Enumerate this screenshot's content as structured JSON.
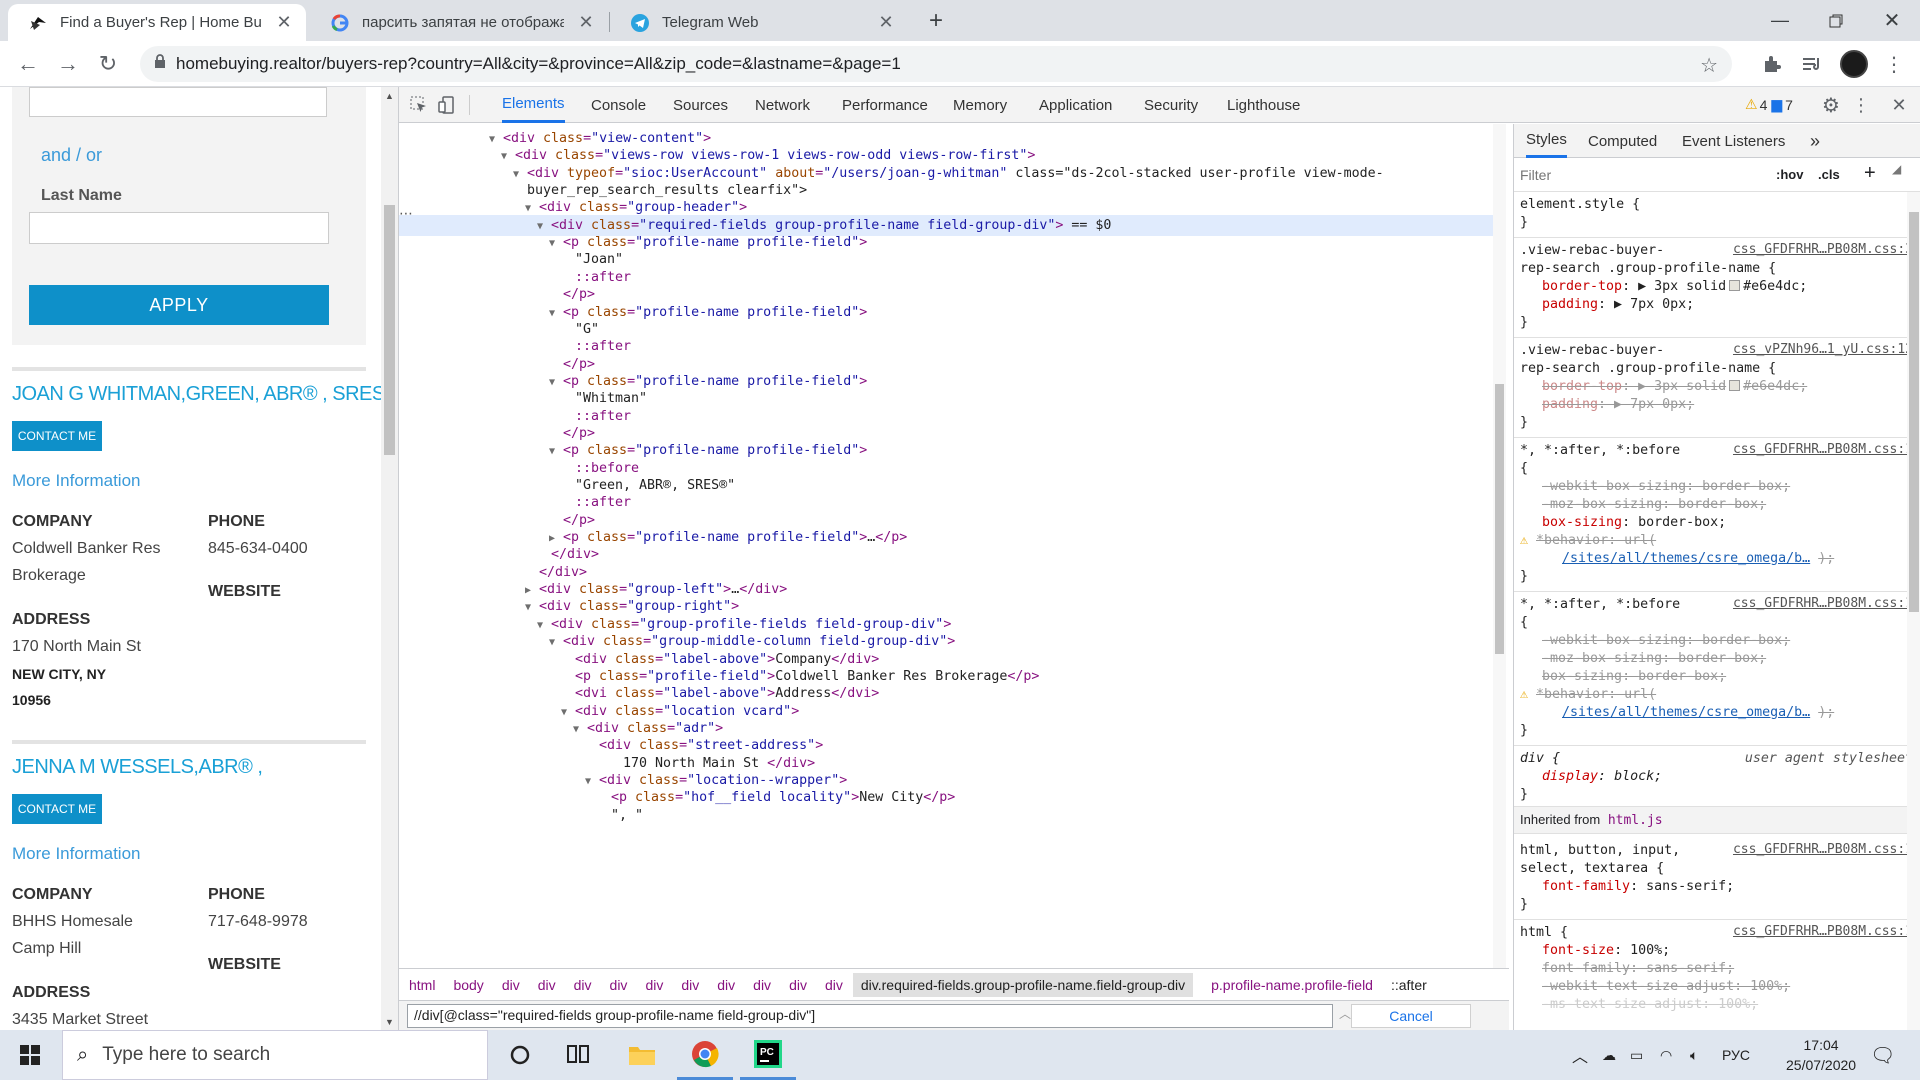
{
  "browser": {
    "tabs": [
      {
        "title": "Find a Buyer's Rep | Home Buying",
        "icon": "realtor-icon",
        "active": true
      },
      {
        "title": "парсить запятая не отображаю",
        "icon": "google-icon",
        "active": false
      },
      {
        "title": "Telegram Web",
        "icon": "telegram-icon",
        "active": false
      }
    ],
    "url": "homebuying.realtor/buyers-rep?country=All&city=&province=All&zip_code=&lastname=&page=1"
  },
  "website": {
    "and_or": "and / or",
    "last_name_label": "Last Name",
    "apply": "APPLY",
    "agents": [
      {
        "name": "JOAN G WHITMAN,GREEN, ABR® , SRES® ,",
        "contact": "CONTACT ME",
        "more": "More Information",
        "company_label": "COMPANY",
        "company_line1": "Coldwell Banker Res",
        "company_line2": "Brokerage",
        "phone_label": "PHONE",
        "phone": "845-634-0400",
        "website_label": "WEBSITE",
        "address_label": "ADDRESS",
        "street": "170 North Main St",
        "city": "NEW CITY, NY",
        "zip": "10956"
      },
      {
        "name": "JENNA M WESSELS,ABR® ,",
        "contact": "CONTACT ME",
        "more": "More Information",
        "company_label": "COMPANY",
        "company_line1": "BHHS Homesale",
        "company_line2": "Camp Hill",
        "phone_label": "PHONE",
        "phone": "717-648-9978",
        "website_label": "WEBSITE",
        "address_label": "ADDRESS",
        "street": "3435 Market Street"
      }
    ]
  },
  "devtools": {
    "tabs": [
      "Elements",
      "Console",
      "Sources",
      "Network",
      "Performance",
      "Memory",
      "Application",
      "Security",
      "Lighthouse"
    ],
    "warnings": "4",
    "messages": "7",
    "dom_lines": [
      {
        "indent": 7,
        "tri": "▼",
        "html": "<div class=\"view-content\">"
      },
      {
        "indent": 8,
        "tri": "▼",
        "html": "<div class=\"views-row views-row-1 views-row-odd views-row-first\">"
      },
      {
        "indent": 9,
        "tri": "▼",
        "html": "<div typeof=\"sioc:UserAccount\" about=\"/users/joan-g-whitman\" class=\"ds-2col-stacked user-profile view-mode-"
      },
      {
        "indent": 9,
        "tri": "",
        "html": "buyer_rep_search_results clearfix\">"
      },
      {
        "indent": 10,
        "tri": "▼",
        "html": "<div class=\"group-header\">"
      },
      {
        "indent": 11,
        "tri": "▼",
        "html": "<div class=\"required-fields group-profile-name field-group-div\"> == $0",
        "selected": true
      },
      {
        "indent": 12,
        "tri": "▼",
        "html": "<p class=\"profile-name profile-field\">"
      },
      {
        "indent": 13,
        "tri": "",
        "html": "\"Joan\""
      },
      {
        "indent": 13,
        "tri": "",
        "html": "::after"
      },
      {
        "indent": 12,
        "tri": "",
        "html": "</p>"
      },
      {
        "indent": 12,
        "tri": "▼",
        "html": "<p class=\"profile-name profile-field\">"
      },
      {
        "indent": 13,
        "tri": "",
        "html": "\"G\""
      },
      {
        "indent": 13,
        "tri": "",
        "html": "::after"
      },
      {
        "indent": 12,
        "tri": "",
        "html": "</p>"
      },
      {
        "indent": 12,
        "tri": "▼",
        "html": "<p class=\"profile-name profile-field\">"
      },
      {
        "indent": 13,
        "tri": "",
        "html": "\"Whitman\""
      },
      {
        "indent": 13,
        "tri": "",
        "html": "::after"
      },
      {
        "indent": 12,
        "tri": "",
        "html": "</p>"
      },
      {
        "indent": 12,
        "tri": "▼",
        "html": "<p class=\"profile-name profile-field\">"
      },
      {
        "indent": 13,
        "tri": "",
        "html": "::before"
      },
      {
        "indent": 13,
        "tri": "",
        "html": "\"Green, ABR®, SRES®\""
      },
      {
        "indent": 13,
        "tri": "",
        "html": "::after"
      },
      {
        "indent": 12,
        "tri": "",
        "html": "</p>"
      },
      {
        "indent": 12,
        "tri": "▶",
        "html": "<p class=\"profile-name profile-field\">…</p>"
      },
      {
        "indent": 11,
        "tri": "",
        "html": "</div>"
      },
      {
        "indent": 10,
        "tri": "",
        "html": "</div>"
      },
      {
        "indent": 10,
        "tri": "▶",
        "html": "<div class=\"group-left\">…</div>"
      },
      {
        "indent": 10,
        "tri": "▼",
        "html": "<div class=\"group-right\">"
      },
      {
        "indent": 11,
        "tri": "▼",
        "html": "<div class=\"group-profile-fields field-group-div\">"
      },
      {
        "indent": 12,
        "tri": "▼",
        "html": "<div class=\"group-middle-column field-group-div\">"
      },
      {
        "indent": 13,
        "tri": "",
        "html": "<div class=\"label-above\">Company</div>"
      },
      {
        "indent": 13,
        "tri": "",
        "html": "<p class=\"profile-field\">Coldwell Banker Res Brokerage</p>"
      },
      {
        "indent": 13,
        "tri": "",
        "html": "<dvi class=\"label-above\">Address</dvi>"
      },
      {
        "indent": 13,
        "tri": "▼",
        "html": "<div class=\"location vcard\">"
      },
      {
        "indent": 14,
        "tri": "▼",
        "html": "<div class=\"adr\">"
      },
      {
        "indent": 15,
        "tri": "",
        "html": "<div class=\"street-address\">"
      },
      {
        "indent": 17,
        "tri": "",
        "html": "170 North Main St              </div>"
      },
      {
        "indent": 15,
        "tri": "▼",
        "html": "<div class=\"location--wrapper\">"
      },
      {
        "indent": 16,
        "tri": "",
        "html": "<p class=\"hof__field locality\">New City</p>"
      },
      {
        "indent": 16,
        "tri": "",
        "html": "\",          \""
      }
    ],
    "breadcrumbs": [
      "html",
      "body",
      "div",
      "div",
      "div",
      "div",
      "div",
      "div",
      "div",
      "div",
      "div",
      "div",
      "div.required-fields.group-profile-name.field-group-div",
      "p.profile-name.profile-field",
      "::after"
    ],
    "search_value": "//div[@class=\"required-fields group-profile-name field-group-div\"]",
    "cancel": "Cancel",
    "styles_tabs": [
      "Styles",
      "Computed",
      "Event Listeners"
    ],
    "filter_placeholder": "Filter",
    "hov": ":hov",
    "cls": ".cls",
    "styles": {
      "element_style": "element.style {",
      "rule1_sel1": ".view-rebac-buyer-",
      "rule1_sel2": "rep-search .group-profile-name {",
      "rule1_src": "css_GFDFRHR…PB08M.css:3",
      "rule1_p1": "border-top",
      "rule1_v1": "3px solid",
      "rule1_c1": "#e6e4dc",
      "rule1_p2": "padding",
      "rule1_v2": "7px 0px",
      "rule2_src": "css_vPZNh96…1_yU.css:12",
      "rule3_sel": "*, *:after, *:before",
      "rule3_src": "css_GFDFRHR…PB08M.css:1",
      "rule3_l1": "-webkit-box-sizing: border-box;",
      "rule3_l2": "-moz-box-sizing: border-box;",
      "rule3_p3": "box-sizing",
      "rule3_v3": "border-box",
      "rule3_l4": "*behavior: url(",
      "rule3_url": "/sites/all/themes/csre_omega/b…",
      "rule4_src": "css_GFDFRHR…PB08M.css:1",
      "div_sel": "div {",
      "div_src": "user agent stylesheet",
      "div_prop": "display",
      "div_val": "block",
      "inherited": "Inherited from",
      "inherited_el": "html.js",
      "rule5_sel1": "html, button, input,",
      "rule5_sel2": "select, textarea {",
      "rule5_src": "css_GFDFRHR…PB08M.css:1",
      "rule5_prop": "font-family",
      "rule5_val": "sans-serif",
      "rule6_sel": "html {",
      "rule6_src": "css_GFDFRHR…PB08M.css:1",
      "rule6_l1p": "font-size",
      "rule6_l1v": "100%",
      "rule6_l2": "font-family: sans-serif;",
      "rule6_l3": "-webkit-text-size-adjust: 100%;",
      "rule6_l4": "-ms-text-size-adjust: 100%;"
    }
  },
  "taskbar": {
    "search_placeholder": "Type here to search",
    "lang": "РУС",
    "time": "17:04",
    "date": "25/07/2020"
  }
}
